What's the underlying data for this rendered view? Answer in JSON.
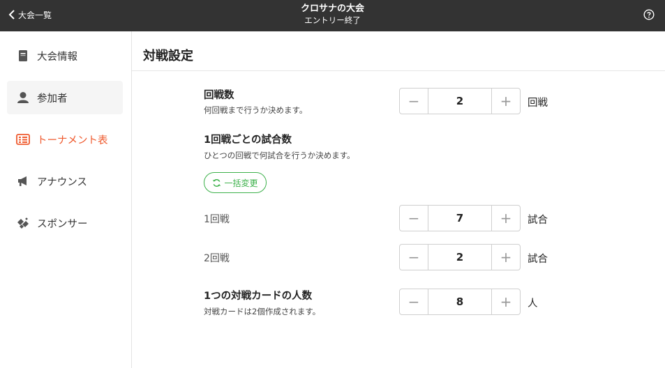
{
  "header": {
    "back_label": "大会一覧",
    "title": "クロサナの大会",
    "subtitle": "エントリー終了"
  },
  "sidebar": {
    "items": [
      {
        "label": "大会情報",
        "icon": "document-icon"
      },
      {
        "label": "参加者",
        "icon": "person-icon"
      },
      {
        "label": "トーナメント表",
        "icon": "tournament-bracket-icon"
      },
      {
        "label": "アナウンス",
        "icon": "megaphone-icon"
      },
      {
        "label": "スポンサー",
        "icon": "sponsor-icon"
      }
    ],
    "active_index": 2
  },
  "main": {
    "title": "対戦設定",
    "rounds": {
      "label": "回戦数",
      "description": "何回戦まで行うか決めます。",
      "value": "2",
      "unit": "回戦"
    },
    "matches_per_round": {
      "label": "1回戦ごとの試合数",
      "description": "ひとつの回戦で何試合を行うか決めます。",
      "bulk_button": "一括変更",
      "rows": [
        {
          "label": "1回戦",
          "value": "7",
          "unit": "試合"
        },
        {
          "label": "2回戦",
          "value": "2",
          "unit": "試合"
        }
      ]
    },
    "players_per_card": {
      "label": "1つの対戦カードの人数",
      "description": "対戦カードは2個作成されます。",
      "value": "8",
      "unit": "人"
    },
    "stepper_symbols": {
      "minus": "−",
      "plus": "+"
    }
  },
  "colors": {
    "header_bg": "#333333",
    "accent": "#ef5a2e",
    "green": "#3cb14a"
  }
}
